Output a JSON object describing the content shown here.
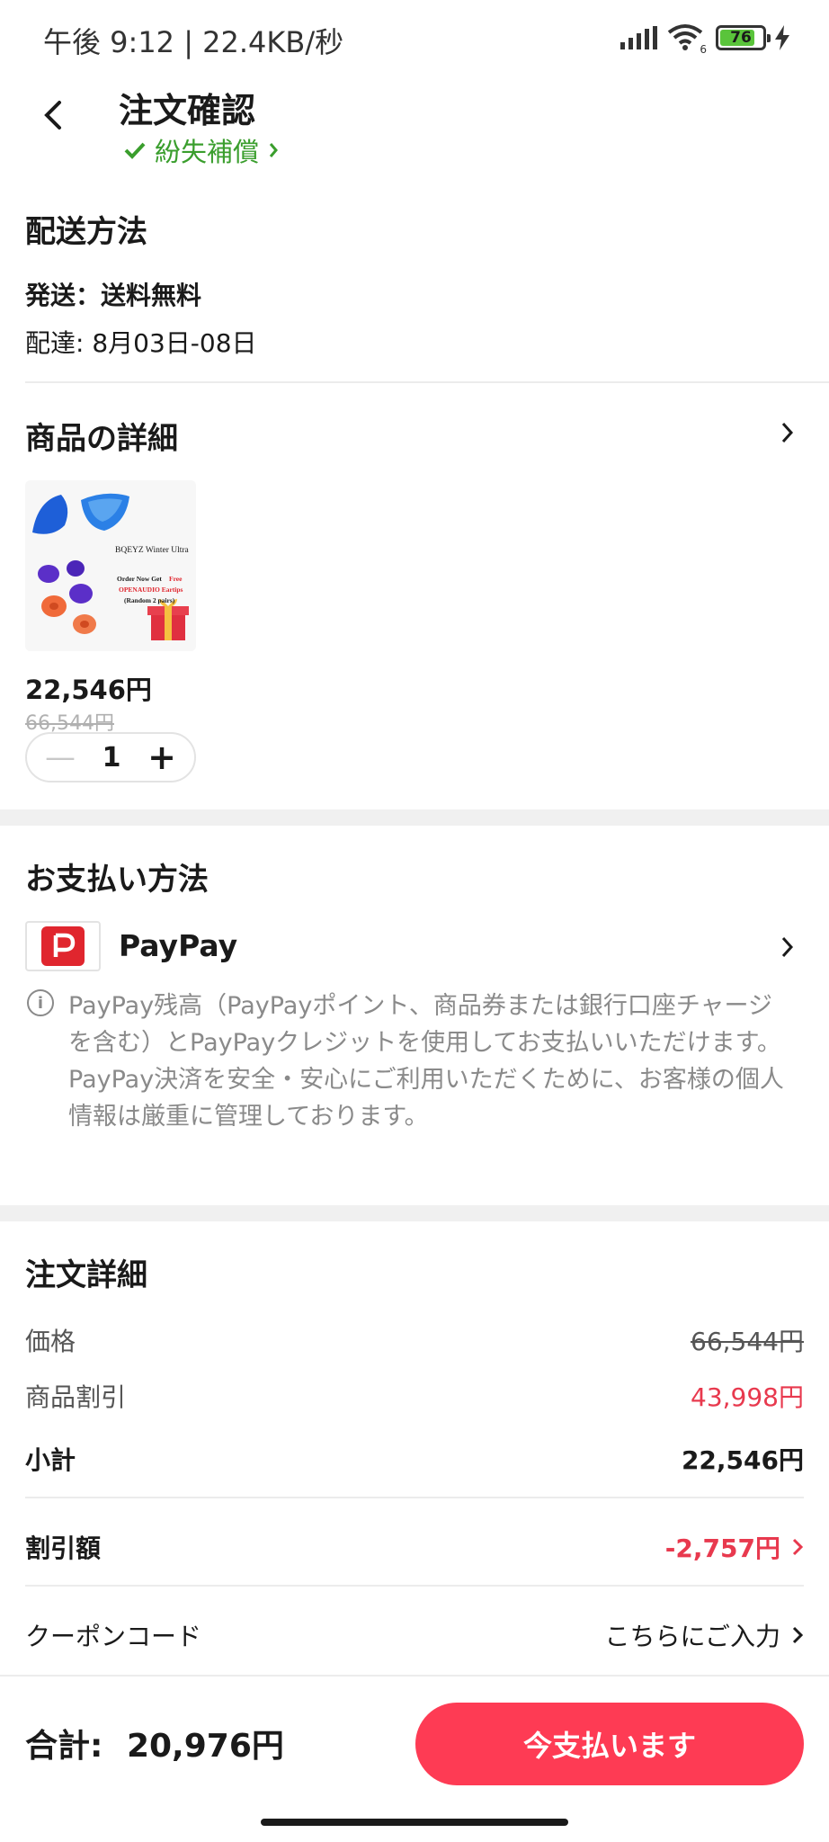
{
  "status_bar": {
    "time": "午後 9:12 | 22.4KB/秒",
    "battery": "76",
    "wifi_sub": "6"
  },
  "header": {
    "title": "注文確認",
    "guarantee": "紛失補償"
  },
  "shipping": {
    "title": "配送方法",
    "ship_line": "発送：送料無料",
    "delivery_line": "配達: 8月03日-08日"
  },
  "product": {
    "title": "商品の詳細",
    "image_texts": [
      "BQEYZ Winter Ultra",
      "Order Now Get",
      "Free",
      "OPENAUDIO Eartips",
      "(Random 2 pairs)"
    ],
    "price": "22,546円",
    "original_price": "66,544円",
    "quantity": "1"
  },
  "payment": {
    "title": "お支払い方法",
    "method": "PayPay",
    "note_1": "PayPay残高（PayPayポイント、商品券または銀行口座チャージを含む）とPayPayクレジットを使用してお支払いいただけます。",
    "note_2": "PayPay決済を安全・安心にご利用いただくために、お客様の個人情報は厳重に管理しております。"
  },
  "order": {
    "title": "注文詳細",
    "price_label": "価格",
    "price_value": "66,544円",
    "discount_label": "商品割引",
    "discount_value": "43,998円",
    "subtotal_label": "小計",
    "subtotal_value": "22,546円",
    "coupon_discount_label": "割引額",
    "coupon_discount_value": "-2,757円",
    "coupon_code_label": "クーポンコード",
    "coupon_code_value": "こちらにご入力"
  },
  "footer": {
    "total_label": "合計:",
    "total_value": "20,976円",
    "pay_button": "今支払います"
  },
  "colors": {
    "accent": "#fe3b54",
    "guarantee_green": "#3a9e2d",
    "discount_red": "#e8394e",
    "paypay_red": "#e0262e"
  }
}
